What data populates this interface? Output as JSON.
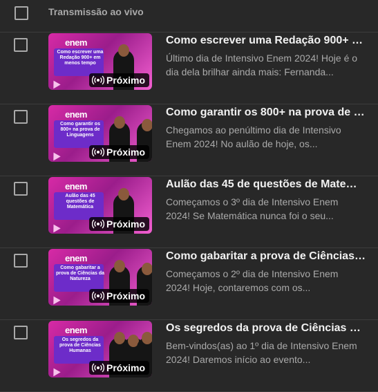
{
  "header": {
    "label": "Transmissão ao vivo"
  },
  "badge_label": "Próximo",
  "rows": [
    {
      "title": "Como escrever uma Redação 900+ e...",
      "description": "Último dia de Intensivo Enem 2024! Hoje é o dia dela brilhar ainda mais: Fernanda...",
      "thumb_logo": "enem",
      "thumb_text": "Como escrever uma Redação 900+ em menos tempo"
    },
    {
      "title": "Como garantir os 800+ na prova de Li...",
      "description": "Chegamos ao penúltimo dia de Intensivo Enem 2024! No aulão de hoje, os...",
      "thumb_logo": "enem",
      "thumb_text": "Como garantir os 800+ na prova de Linguagens"
    },
    {
      "title": "Aulão das 45 de questões de Matemá...",
      "description": "Começamos o 3º dia de Intensivo Enem 2024! Se Matemática nunca foi o seu...",
      "thumb_logo": "enem",
      "thumb_text": "Aulão das 45 questões de Matemática"
    },
    {
      "title": "Como gabaritar a prova de Ciências d...",
      "description": "Começamos o 2º dia de Intensivo Enem 2024! Hoje, contaremos com os...",
      "thumb_logo": "enem",
      "thumb_text": "Como gabaritar a prova de Ciências da Natureza"
    },
    {
      "title": "Os segredos da prova de Ciências Hu...",
      "description": "Bem-vindos(as) ao 1º dia de Intensivo Enem 2024! Daremos início ao evento...",
      "thumb_logo": "enem",
      "thumb_text": "Os segredos da prova de Ciências Humanas"
    }
  ]
}
